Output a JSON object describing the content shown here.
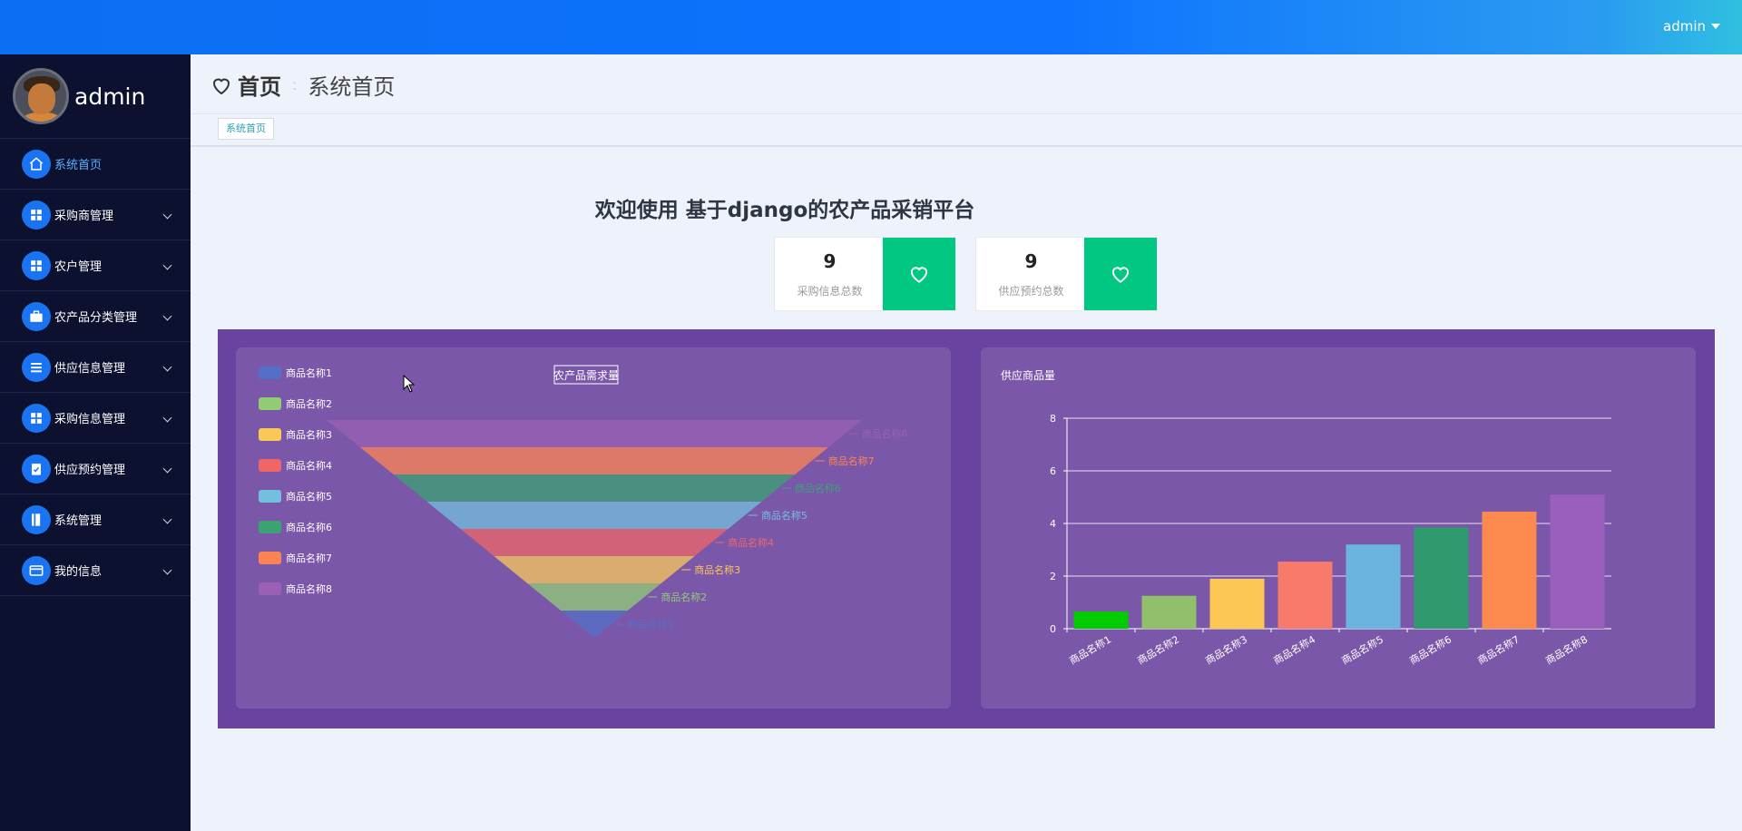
{
  "topbar": {
    "user": "admin"
  },
  "sidebar": {
    "profile_name": "admin",
    "items": [
      {
        "label": "系统首页",
        "icon": "home-icon",
        "active": true,
        "has_sub": false
      },
      {
        "label": "采购商管理",
        "icon": "grid-icon",
        "active": false,
        "has_sub": true
      },
      {
        "label": "农户管理",
        "icon": "grid-icon",
        "active": false,
        "has_sub": true
      },
      {
        "label": "农产品分类管理",
        "icon": "briefcase-icon",
        "active": false,
        "has_sub": true
      },
      {
        "label": "供应信息管理",
        "icon": "list-icon",
        "active": false,
        "has_sub": true
      },
      {
        "label": "采购信息管理",
        "icon": "grid-icon",
        "active": false,
        "has_sub": true
      },
      {
        "label": "供应预约管理",
        "icon": "clipboard-icon",
        "active": false,
        "has_sub": true
      },
      {
        "label": "系统管理",
        "icon": "book-icon",
        "active": false,
        "has_sub": true
      },
      {
        "label": "我的信息",
        "icon": "card-icon",
        "active": false,
        "has_sub": true
      }
    ]
  },
  "header": {
    "crumb_home": "首页",
    "crumb_current": "系统首页"
  },
  "tabs": [
    {
      "label": "系统首页"
    }
  ],
  "welcome": "欢迎使用 基于django的农产品采销平台",
  "stats": [
    {
      "value": "9",
      "caption": "采购信息总数"
    },
    {
      "value": "9",
      "caption": "供应预约总数"
    }
  ],
  "colors": {
    "accent": "#0d72ff",
    "heart_bg": "#00c882",
    "panel_bg": "#6a43a1",
    "card_bg": "#7b57aa",
    "series": [
      "#5470c6",
      "#91cc75",
      "#fac858",
      "#ee6666",
      "#73c0de",
      "#3ba272",
      "#fc8452",
      "#9a60b4"
    ]
  },
  "chart_data": [
    {
      "type": "funnel",
      "title": "农产品需求量",
      "legend": [
        "商品名称1",
        "商品名称2",
        "商品名称3",
        "商品名称4",
        "商品名称5",
        "商品名称6",
        "商品名称7",
        "商品名称8"
      ],
      "legend_position": "left",
      "categories": [
        "商品名称8",
        "商品名称7",
        "商品名称6",
        "商品名称5",
        "商品名称4",
        "商品名称3",
        "商品名称2",
        "商品名称1"
      ],
      "values": [
        8,
        7,
        6,
        5,
        4,
        3,
        2,
        1
      ]
    },
    {
      "type": "bar",
      "title": "供应商品量",
      "categories": [
        "商品名称1",
        "商品名称2",
        "商品名称3",
        "商品名称4",
        "商品名称5",
        "商品名称6",
        "商品名称7",
        "商品名称8"
      ],
      "values": [
        0.65,
        1.25,
        1.9,
        2.55,
        3.2,
        3.85,
        4.45,
        5.1
      ],
      "colors": [
        "#00cc00",
        "#91bf6a",
        "#fcc755",
        "#f77a6a",
        "#6cb4e0",
        "#2f9a6d",
        "#fc8a4e",
        "#9a5fbc"
      ],
      "ylim": [
        0,
        8
      ],
      "yticks": [
        0,
        2,
        4,
        6,
        8
      ],
      "grid": true
    }
  ]
}
